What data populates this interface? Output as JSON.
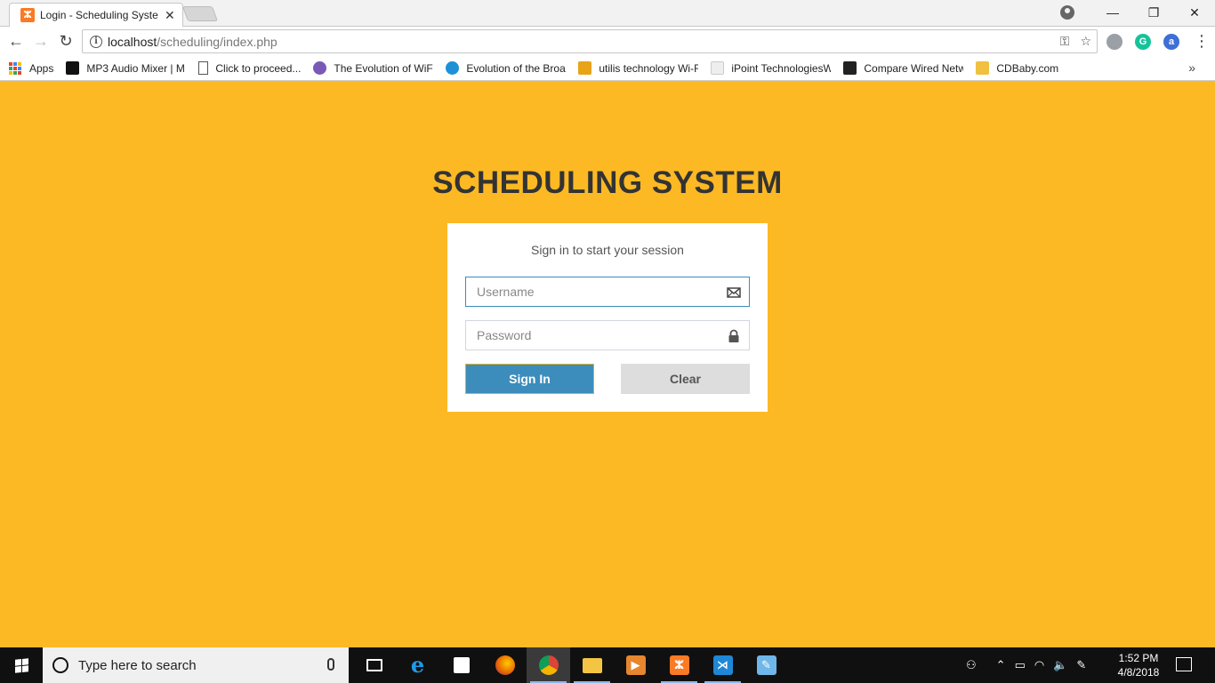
{
  "browser": {
    "tab": {
      "title": "Login - Scheduling Syste",
      "favicon": "xampp-icon"
    },
    "window_controls": [
      "minimize",
      "restore",
      "close"
    ],
    "url": {
      "host": "localhost",
      "path": "/scheduling/index.php"
    },
    "bookmarks": [
      {
        "label": "Apps",
        "icon": "apps-grid-icon",
        "color": "#4285f4"
      },
      {
        "label": "MP3 Audio Mixer | M",
        "icon": "audio-icon",
        "color": "#111111"
      },
      {
        "label": "Click to proceed...",
        "icon": "page-icon",
        "color": "#ffffff"
      },
      {
        "label": "The Evolution of WiFi",
        "icon": "wifi-icon",
        "color": "#7a5ab5"
      },
      {
        "label": "Evolution of the Broa",
        "icon": "globe-icon",
        "color": "#1e90d6"
      },
      {
        "label": "utilis technology Wi-F",
        "icon": "u-icon",
        "color": "#e8a317"
      },
      {
        "label": "iPoint TechnologiesW",
        "icon": "blank-page-icon",
        "color": "#eeeeee"
      },
      {
        "label": "Compare Wired Netw",
        "icon": "g-icon",
        "color": "#222222"
      },
      {
        "label": "CDBaby.com",
        "icon": "cdbaby-icon",
        "color": "#f0c040"
      }
    ]
  },
  "page": {
    "title": "SCHEDULING SYSTEM",
    "login_message": "Sign in to start your session",
    "username_placeholder": "Username",
    "password_placeholder": "Password",
    "sign_in_label": "Sign In",
    "clear_label": "Clear",
    "colors": {
      "background": "#fdb924",
      "primary": "#3c8dbc",
      "title": "#333333"
    }
  },
  "taskbar": {
    "search_placeholder": "Type here to search",
    "time": "1:52 PM",
    "date": "4/8/2018",
    "apps": [
      {
        "name": "task-view-icon",
        "label": "▭",
        "color": "#101010"
      },
      {
        "name": "edge-icon",
        "label": "e",
        "color": "#1e7fd8"
      },
      {
        "name": "store-icon",
        "label": "🛍",
        "color": "#101010"
      },
      {
        "name": "firefox-icon",
        "label": "",
        "color": "#e66000"
      },
      {
        "name": "chrome-icon",
        "label": "",
        "color": "#db4437"
      },
      {
        "name": "file-explorer-icon",
        "label": "",
        "color": "#f4c542"
      },
      {
        "name": "media-player-icon",
        "label": "▶",
        "color": "#e6862e"
      },
      {
        "name": "xampp-icon",
        "label": "ⵣ",
        "color": "#fb7a24"
      },
      {
        "name": "visual-studio-code-icon",
        "label": "⋊",
        "color": "#1e88d6"
      },
      {
        "name": "notepad-icon",
        "label": "✎",
        "color": "#6fb7e9"
      }
    ]
  }
}
